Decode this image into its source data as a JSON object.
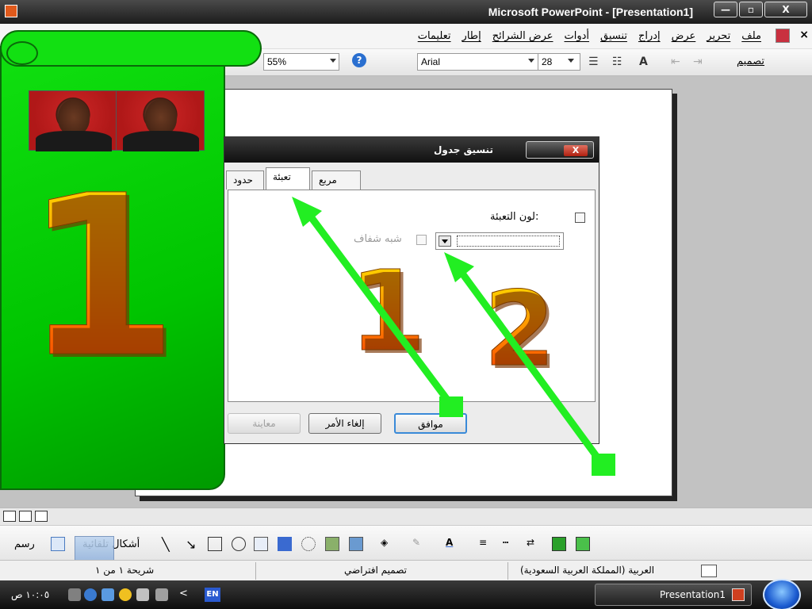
{
  "window": {
    "title": "Microsoft PowerPoint - [Presentation1]",
    "min_label": "—",
    "max_label": "▫",
    "close_label": "X"
  },
  "menu": {
    "items": [
      "ملف",
      "تحرير",
      "عرض",
      "إدراج",
      "تنسيق",
      "أدوات",
      "عرض الشرائح",
      "إطار",
      "تعليمات"
    ],
    "close_label": "×"
  },
  "toolbar": {
    "zoom": "55%",
    "font_name": "Arial",
    "font_size": "28",
    "design_label": "تصميم",
    "help_glyph": "?"
  },
  "slide": {
    "big_number": "1"
  },
  "dialog": {
    "title": "تنسيق جدول",
    "tabs": [
      "حدود",
      "تعبئة",
      "مربع نص"
    ],
    "active_tab": "تعبئة",
    "fill_color_label": "لون التعبئة:",
    "semi_transparent_label": "شبه شفاف",
    "ok_label": "موافق",
    "cancel_label": "إلغاء الأمر",
    "preview_label": "معاينة",
    "close_glyph": "X"
  },
  "callouts": {
    "label_1": "1",
    "label_2": "2",
    "arrow_color": "#22ee22"
  },
  "drawing_toolbar": {
    "draw_label": "رسم",
    "autoshapes_label": "أشكال تلقائية"
  },
  "status": {
    "slide_info": "شريحة ١ من ١",
    "design": "تصميم افتراضي",
    "language": "العربية (المملكة العربية السعودية)"
  },
  "taskbar": {
    "time": "١٠:٠٥ ص",
    "lang": "EN",
    "task_label": "Presentation1",
    "tray_chevron": "<"
  },
  "colors": {
    "banner_green": "#00c400",
    "digit_orange": "#ff8a00",
    "digit_yellow": "#ffe000",
    "title_bar": "#1c1c1c"
  }
}
